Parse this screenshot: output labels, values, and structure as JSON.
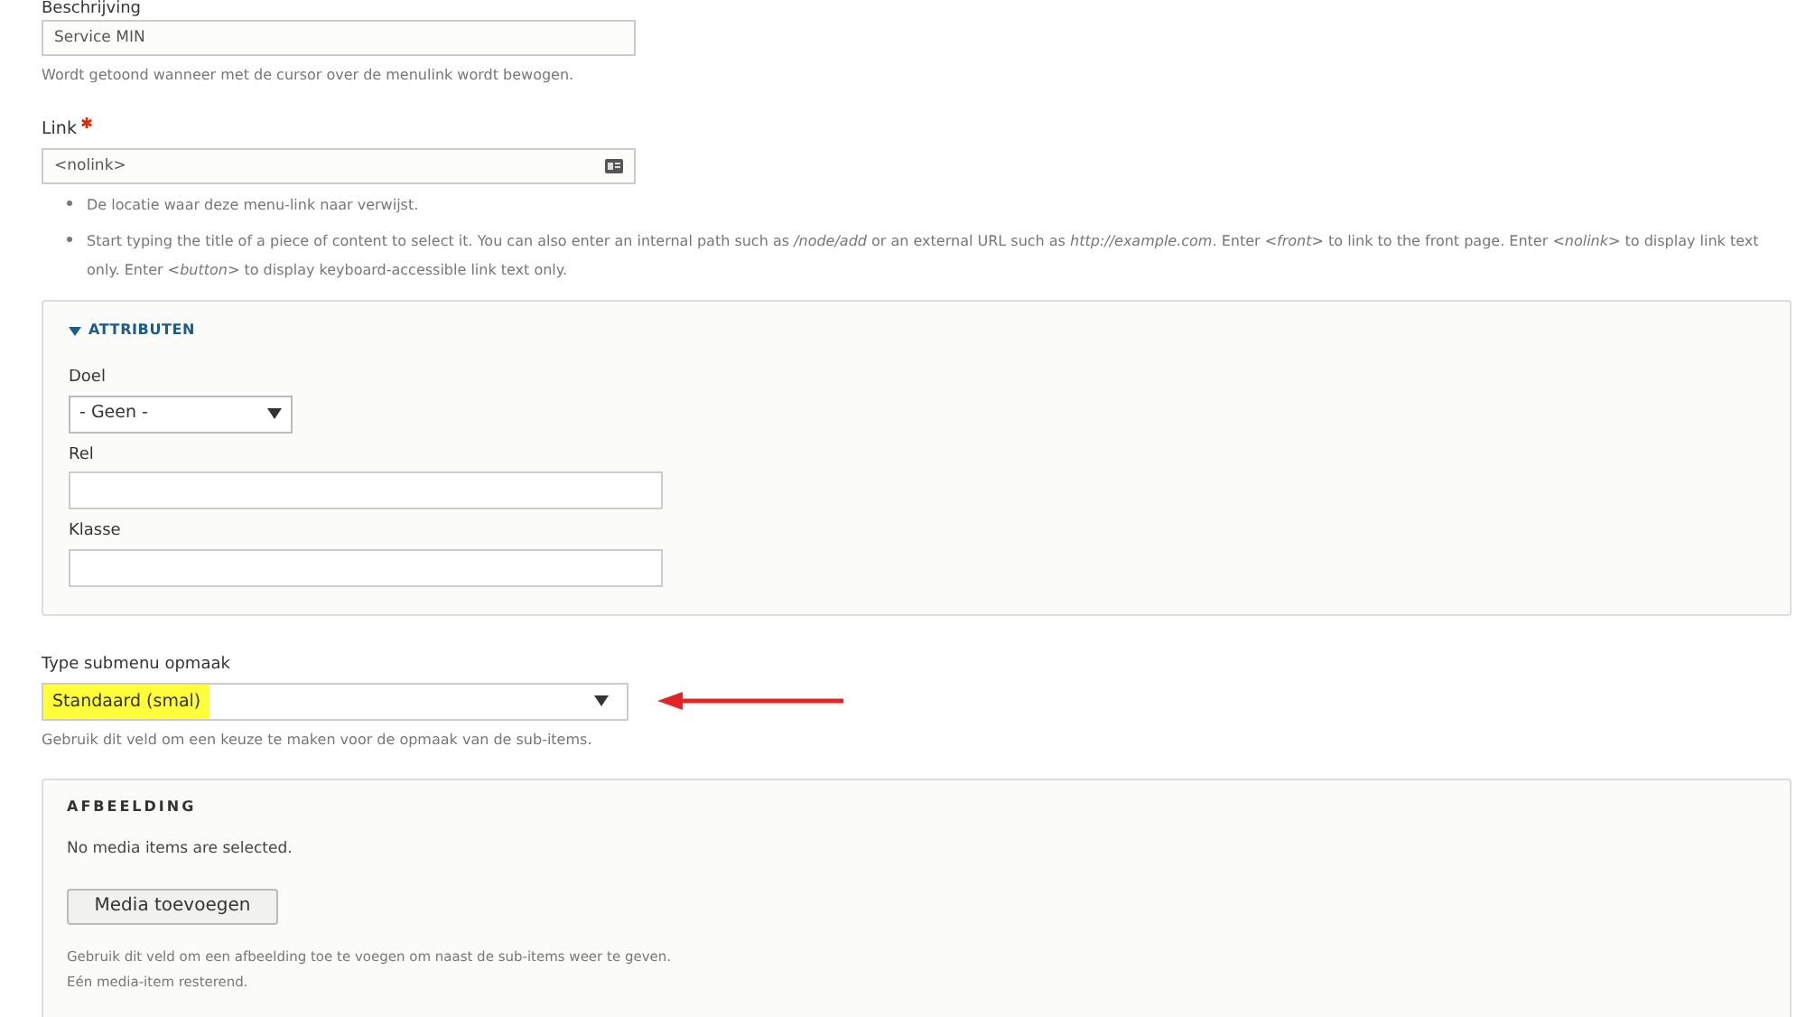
{
  "description_field": {
    "label": "Beschrijving",
    "value": "Service MIN",
    "help": "Wordt getoond wanneer met de cursor over de menulink wordt bewogen."
  },
  "link_field": {
    "label": "Link",
    "required": true,
    "value": "<nolink>",
    "help_items": [
      "De locatie waar deze menu-link naar verwijst.",
      "Start typing the title of a piece of content to select it. You can also enter an internal path such as */node/add* or an external URL such as *http://example.com*. Enter *<front>* to link to the front page. Enter *<nolink>* to display link text only. Enter *<button>* to display keyboard-accessible link text only."
    ]
  },
  "attributes": {
    "title": "ATTRIBUTEN",
    "expanded": true,
    "fields": [
      {
        "kind": "select",
        "label": "Doel",
        "value": "- Geen -"
      },
      {
        "kind": "text",
        "label": "Rel"
      },
      {
        "kind": "text",
        "label": "Klasse"
      }
    ]
  },
  "submenu_type": {
    "label": "Type submenu opmaak",
    "value": "Standaard (smal)",
    "highlighted": true,
    "help": "Gebruik dit veld om een keuze te maken voor de opmaak van de sub-items."
  },
  "image": {
    "title": "AFBEELDING",
    "status": "No media items are selected.",
    "button": "Media toevoegen",
    "help": [
      "Gebruik dit veld om een afbeelding toe te voegen om naast de sub-items weer te geven.",
      "Eén media-item resterend."
    ]
  }
}
